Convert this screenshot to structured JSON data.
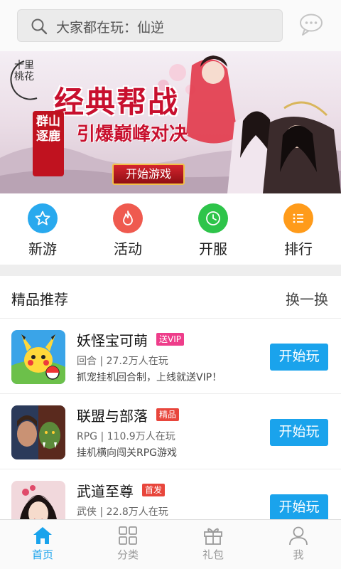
{
  "search": {
    "placeholder": "大家都在玩：仙逆"
  },
  "banner": {
    "brand": "十里桃花",
    "headline": "经典帮战",
    "subline": "引爆巅峰对决",
    "seal": "群山逐鹿",
    "cta": "开始游戏"
  },
  "quicknav": [
    {
      "label": "新游",
      "icon": "star-icon",
      "color": "#29a9ee"
    },
    {
      "label": "活动",
      "icon": "flame-icon",
      "color": "#ef5a4f"
    },
    {
      "label": "开服",
      "icon": "clock-icon",
      "color": "#2ec44a"
    },
    {
      "label": "排行",
      "icon": "list-icon",
      "color": "#ff9b1a"
    }
  ],
  "section": {
    "title": "精品推荐",
    "refresh": "换一换"
  },
  "games": [
    {
      "name": "妖怪宝可萌",
      "badge": "送VIP",
      "badge_color": "#ee3d8a",
      "meta": "回合 | 27.2万人在玩",
      "desc": "抓宠挂机回合制，上线就送VIP！",
      "action": "开始玩"
    },
    {
      "name": "联盟与部落",
      "badge": "精品",
      "badge_color": "#e8463c",
      "meta": "RPG | 110.9万人在玩",
      "desc": "挂机横向闯关RPG游戏",
      "action": "开始玩"
    },
    {
      "name": "武道至尊",
      "badge": "首发",
      "badge_color": "#e8463c",
      "meta": "武侠 | 22.8万人在玩",
      "desc": "",
      "action": "开始玩"
    }
  ],
  "tabs": [
    {
      "label": "首页",
      "icon": "home-icon",
      "active": true
    },
    {
      "label": "分类",
      "icon": "grid-icon",
      "active": false
    },
    {
      "label": "礼包",
      "icon": "gift-icon",
      "active": false
    },
    {
      "label": "我",
      "icon": "user-icon",
      "active": false
    }
  ],
  "colors": {
    "accent": "#1aa3ec",
    "tab_active": "#1aa3ec",
    "tab_inactive": "#9a9a9a"
  }
}
